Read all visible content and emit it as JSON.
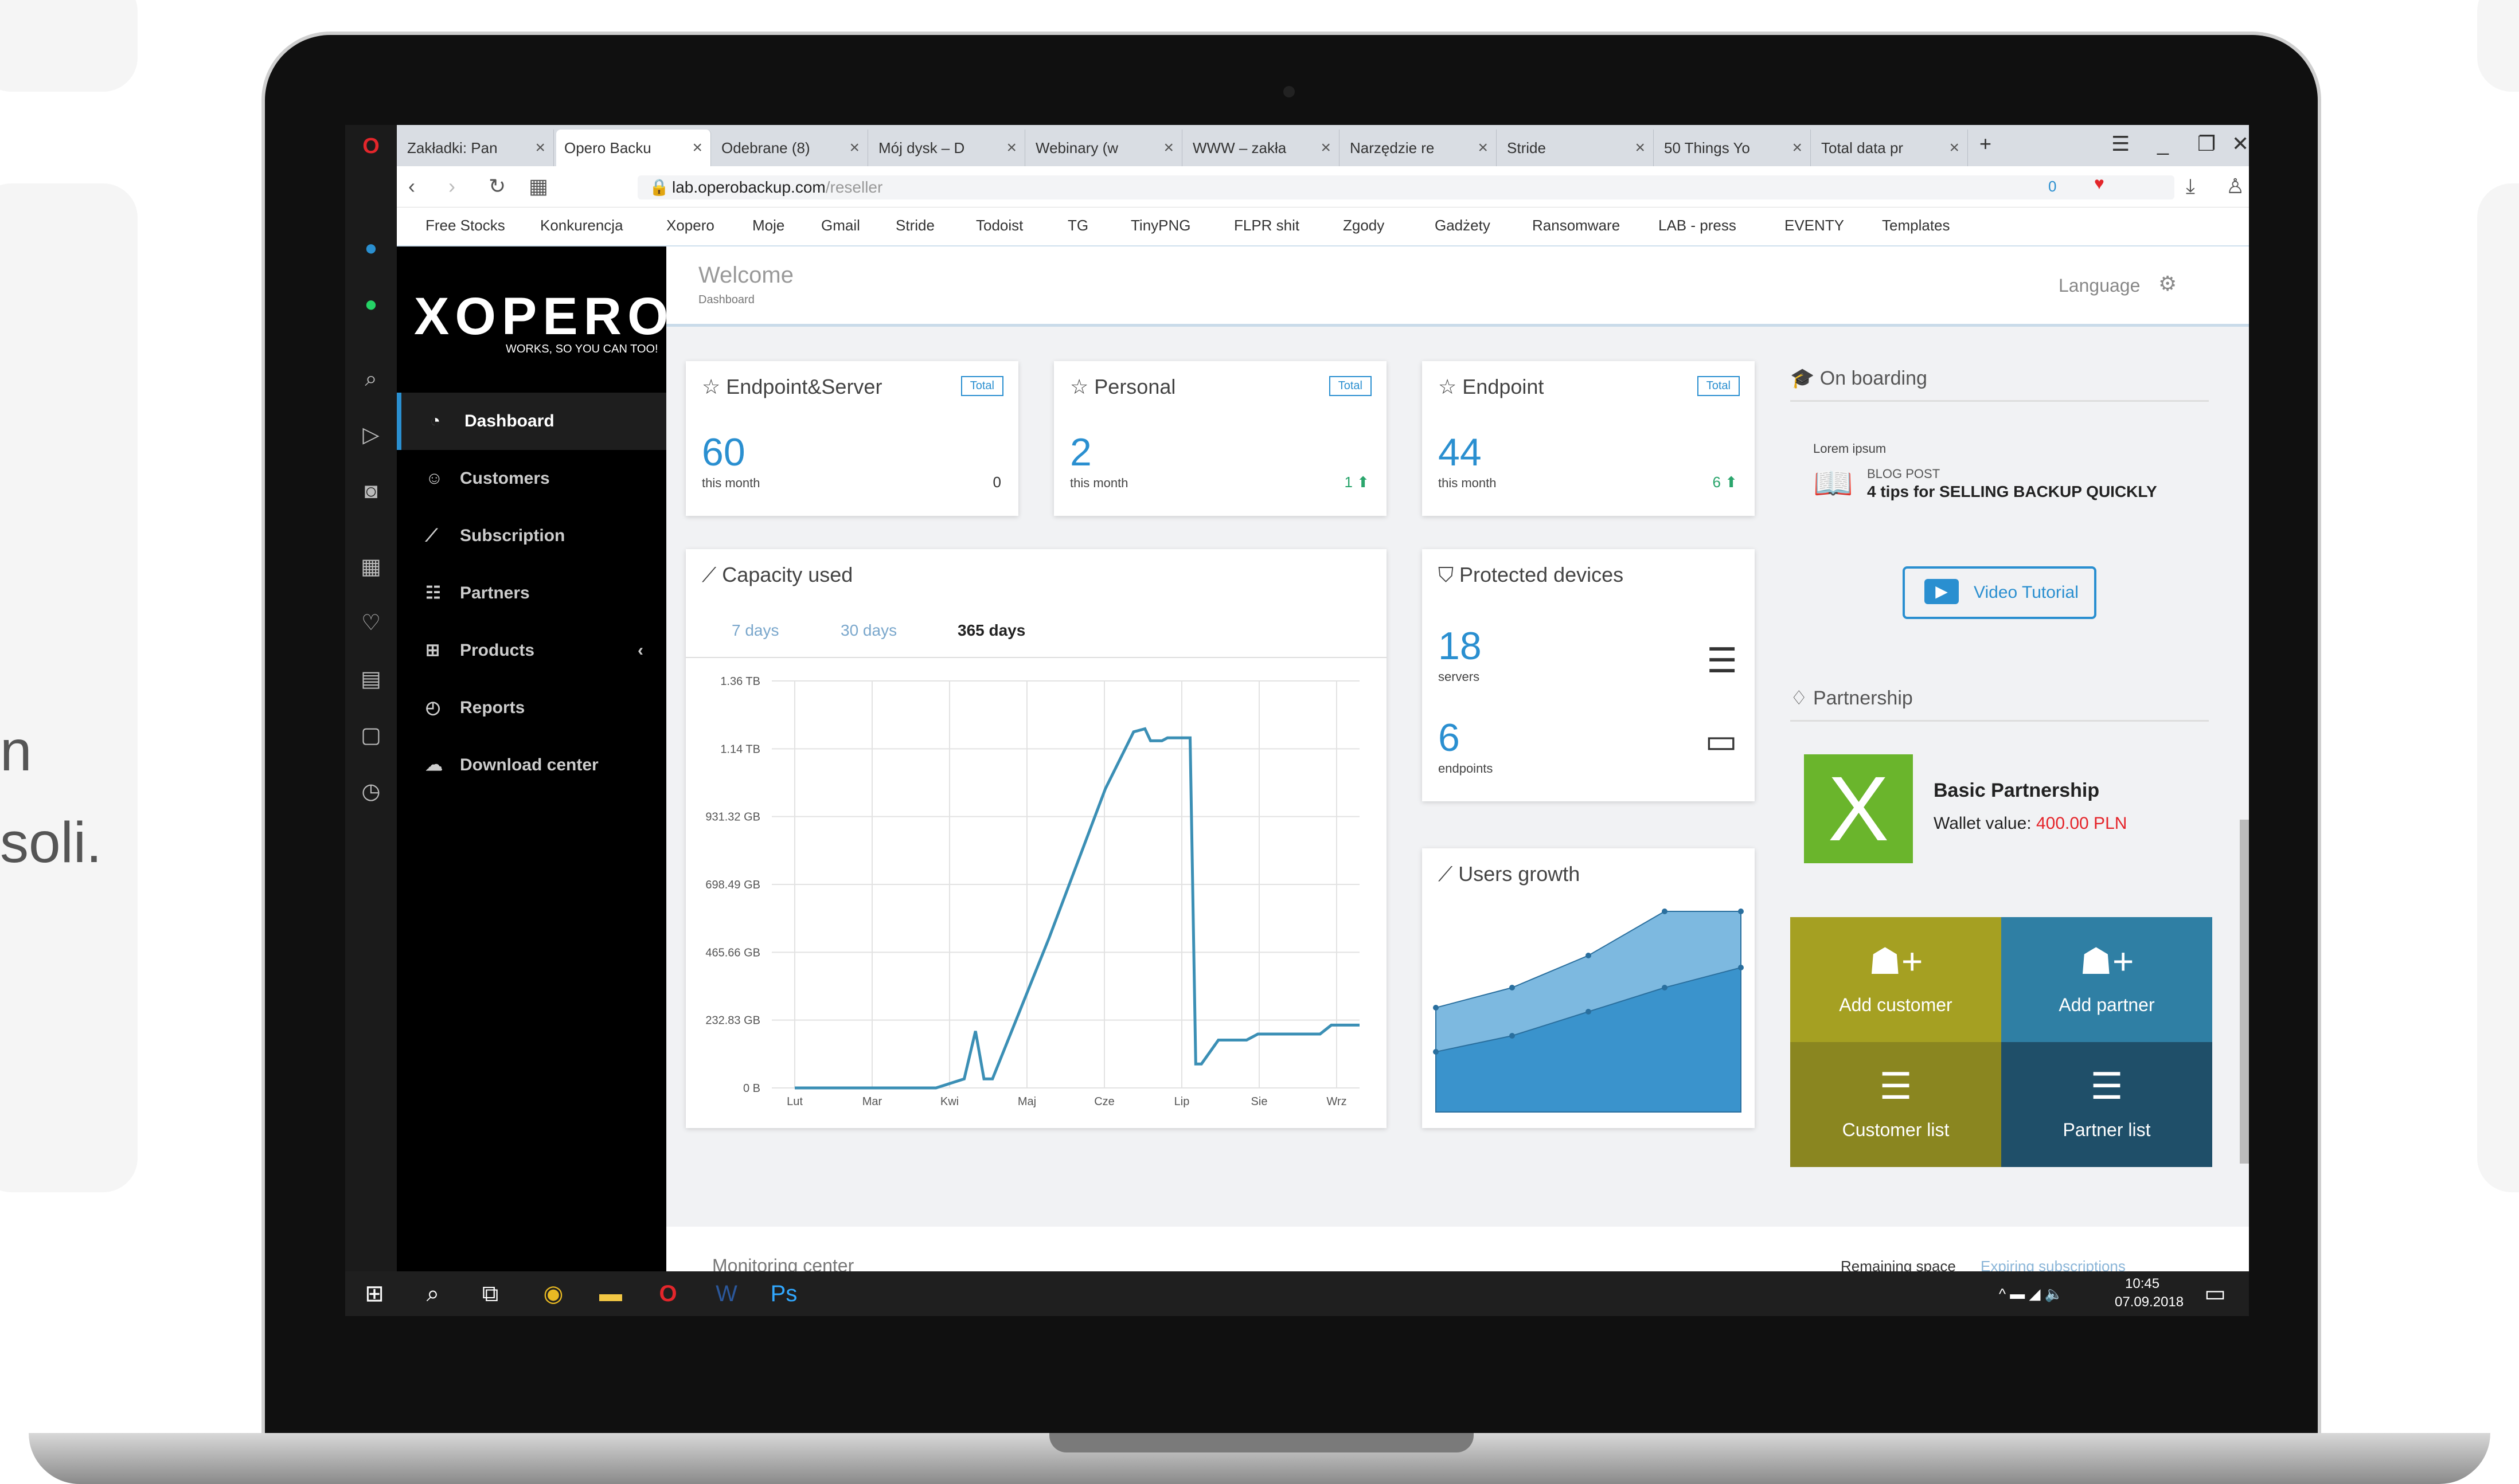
{
  "page_text": {
    "line1": "n",
    "line2": "soli."
  },
  "browser": {
    "tabs": [
      {
        "label": "Zakładki: Pan"
      },
      {
        "label": "Opero Backu"
      },
      {
        "label": "Odebrane (8)"
      },
      {
        "label": "Mój dysk – D"
      },
      {
        "label": "Webinary (w"
      },
      {
        "label": "WWW – zakła"
      },
      {
        "label": "Narzędzie re"
      },
      {
        "label": "Stride"
      },
      {
        "label": "50 Things Yo"
      },
      {
        "label": "Total data pr"
      }
    ],
    "new_tab": "+",
    "url_host": "lab.operobackup.com",
    "url_path": "/reseller",
    "ext_count": "0",
    "bookmarks": [
      "Free Stocks",
      "Konkurencja",
      "Xopero",
      "Moje",
      "Gmail",
      "Stride",
      "Todoist",
      "TG",
      "TinyPNG",
      "FLPR shit",
      "Zgody",
      "Gadżety",
      "Ransomware",
      "LAB - press",
      "EVENTY",
      "Templates"
    ]
  },
  "sidebar": {
    "logo": "XOPERO",
    "tagline": "WORKS, SO YOU CAN TOO!",
    "items": [
      {
        "label": "Dashboard"
      },
      {
        "label": "Customers"
      },
      {
        "label": "Subscription"
      },
      {
        "label": "Partners"
      },
      {
        "label": "Products"
      },
      {
        "label": "Reports"
      },
      {
        "label": "Download center"
      }
    ],
    "products_chevron": "‹"
  },
  "header": {
    "title": "Welcome",
    "breadcrumb": "Dashboard",
    "language": "Language"
  },
  "stats": [
    {
      "title": "Endpoint&Server",
      "badge": "Total",
      "value": "60",
      "sub": "this month",
      "delta": "0"
    },
    {
      "title": "Personal",
      "badge": "Total",
      "value": "2",
      "sub": "this month",
      "delta": "1 ⬆"
    },
    {
      "title": "Endpoint",
      "badge": "Total",
      "value": "44",
      "sub": "this month",
      "delta": "6 ⬆"
    }
  ],
  "capacity": {
    "title": "Capacity used",
    "tabs": [
      "7 days",
      "30 days",
      "365 days"
    ],
    "active_tab": "365 days"
  },
  "chart_data": {
    "type": "line",
    "title": "Capacity used",
    "categories": [
      "Lut",
      "Mar",
      "Kwi",
      "Maj",
      "Cze",
      "Lip",
      "Sie",
      "Wrz"
    ],
    "y_ticks": [
      "1.36 TB",
      "1.14 TB",
      "931.32 GB",
      "698.49 GB",
      "465.66 GB",
      "232.83 GB",
      "0 B"
    ],
    "ylim": [
      0,
      1.36
    ],
    "series": [
      {
        "x": [
          0,
          0.15,
          0.25,
          0.3,
          0.32,
          0.335,
          0.35,
          0.45,
          0.55,
          0.6,
          0.62,
          0.63,
          0.65,
          0.66,
          0.7,
          0.71,
          0.72,
          0.75,
          0.8,
          0.82,
          0.86,
          0.93,
          0.95,
          1.0
        ],
        "values": [
          0,
          0,
          0,
          0.03,
          0.19,
          0.03,
          0.03,
          0.5,
          1.0,
          1.19,
          1.2,
          1.16,
          1.16,
          1.17,
          1.17,
          0.08,
          0.08,
          0.16,
          0.16,
          0.18,
          0.18,
          0.18,
          0.21,
          0.21
        ]
      }
    ],
    "grid": true
  },
  "protected": {
    "title": "Protected devices",
    "servers_value": "18",
    "servers_label": "servers",
    "endpoints_value": "6",
    "endpoints_label": "endpoints"
  },
  "users_growth": {
    "title": "Users growth",
    "chart_data": {
      "type": "area",
      "title": "Users growth",
      "x": [
        0,
        1,
        2,
        3,
        4
      ],
      "series": [
        {
          "values": [
            0.52,
            0.62,
            0.78,
            1.0,
            1.0
          ]
        },
        {
          "values": [
            0.3,
            0.38,
            0.5,
            0.62,
            0.72
          ]
        }
      ]
    }
  },
  "onboarding": {
    "title": "On boarding",
    "lorem": "Lorem ipsum",
    "blog_label": "BLOG POST",
    "blog_title": "4 tips for SELLING BACKUP QUICKLY",
    "video_btn": "Video Tutorial"
  },
  "partnership": {
    "title": "Partnership",
    "level": "Basic Partnership",
    "wallet_label": "Wallet value:",
    "wallet_value": "400.00 PLN"
  },
  "tiles": [
    {
      "label": "Add customer",
      "color": "#a5a022"
    },
    {
      "label": "Add partner",
      "color": "#2f7fa4"
    },
    {
      "label": "Customer list",
      "color": "#8a8620"
    },
    {
      "label": "Partner list",
      "color": "#1f4f69"
    }
  ],
  "footer": {
    "monitoring": "Monitoring center",
    "remaining": "Remaining space",
    "expiring": "Expiring subscriptions"
  },
  "taskbar": {
    "time": "10:45",
    "date": "07.09.2018"
  },
  "colors": {
    "accent": "#2a8fd0",
    "wallet": "#e5242a"
  }
}
